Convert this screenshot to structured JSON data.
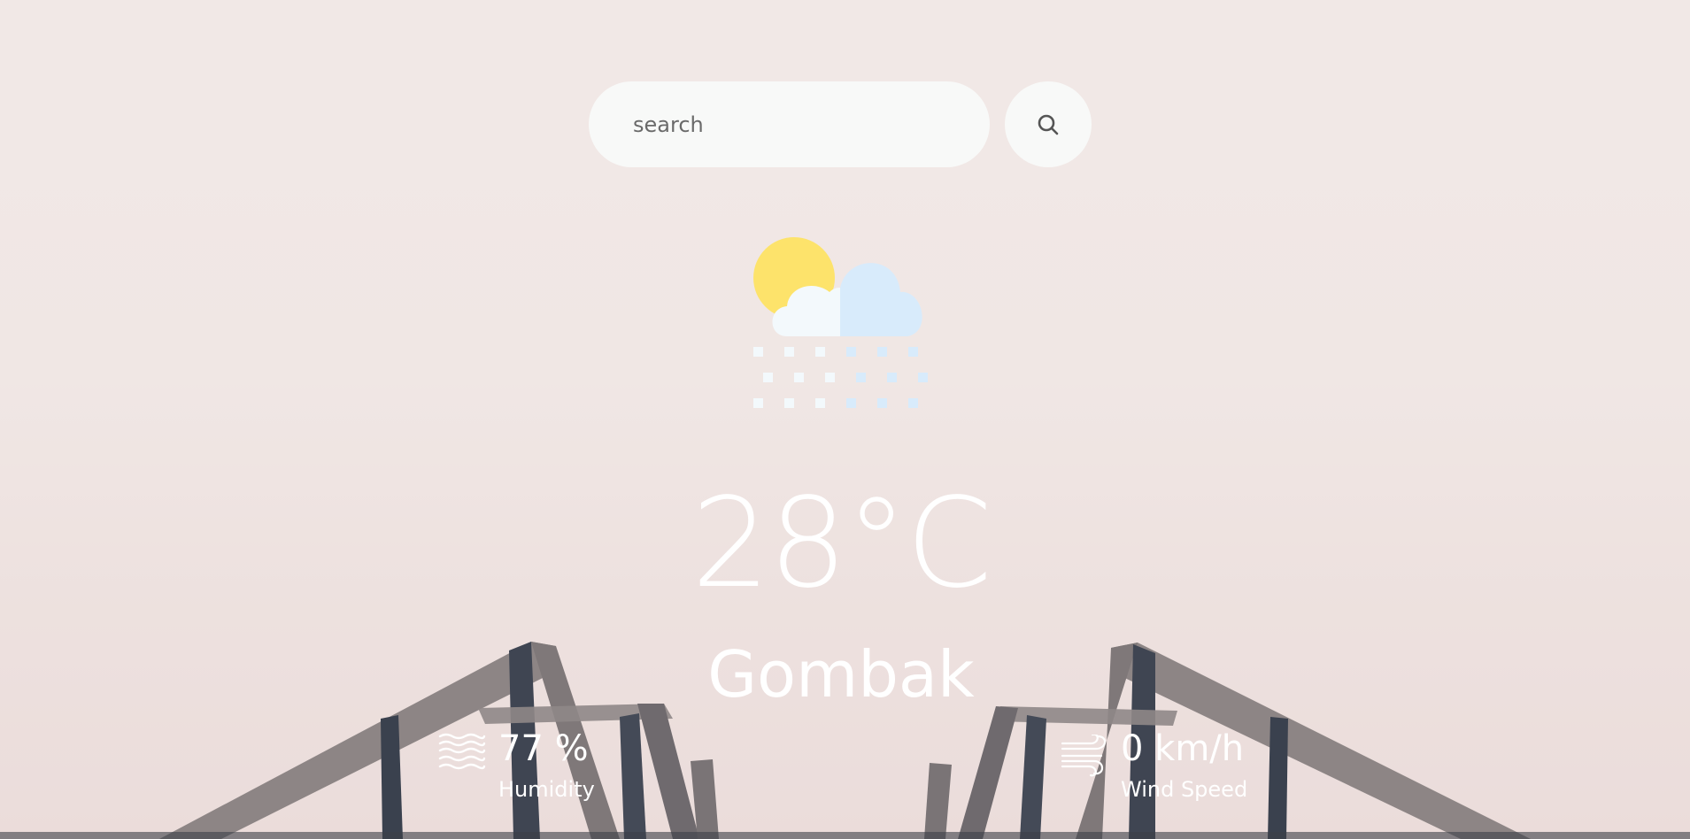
{
  "search": {
    "placeholder": "search",
    "button_icon": "search-icon"
  },
  "weather": {
    "icon": "partly-cloudy-snow-icon",
    "temperature": "28°C",
    "city": "Gombak"
  },
  "details": {
    "humidity": {
      "icon": "humidity-waves-icon",
      "value": "77 %",
      "label": "Humidity"
    },
    "wind": {
      "icon": "wind-icon",
      "value": "0 km/h",
      "label": "Wind Speed"
    }
  },
  "colors": {
    "text": "#ffffff",
    "input_bg": "#f8f9f8",
    "sun": "#fde36b",
    "cloud_light": "#f3f9fc",
    "cloud_blue": "#d8ebfb"
  }
}
